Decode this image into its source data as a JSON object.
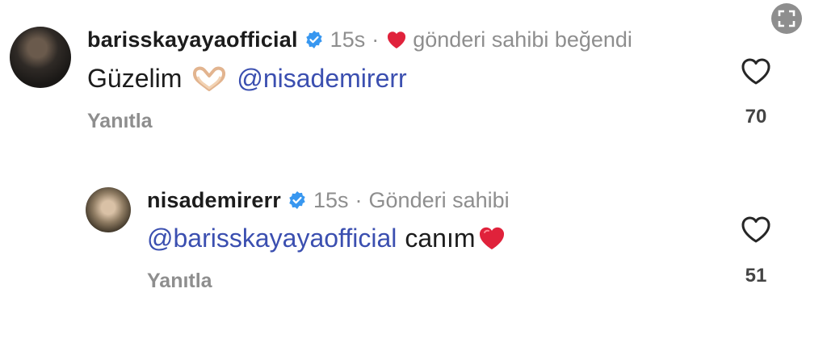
{
  "comments": [
    {
      "username": "barisskayayaofficial",
      "time": "15s",
      "meta": "gönderi sahibi beğendi",
      "text": "Güzelim",
      "mention": "@nisademirerr",
      "reply_label": "Yanıtla",
      "likes": "70"
    },
    {
      "username": "nisademirerr",
      "time": "15s",
      "meta": "Gönderi sahibi",
      "mention": "@barisskayayaofficial",
      "text": "canım",
      "reply_label": "Yanıtla",
      "likes": "51"
    }
  ],
  "separator": "·",
  "icons": {
    "verified": "verified-badge-icon",
    "liked_by_author": "heart-filled-icon",
    "like": "heart-outline-icon",
    "expand": "expand-icon"
  },
  "colors": {
    "mention": "#3b4fb0",
    "verified": "#3897f0",
    "heart": "#e0223b",
    "muted": "#8e8e8e"
  }
}
